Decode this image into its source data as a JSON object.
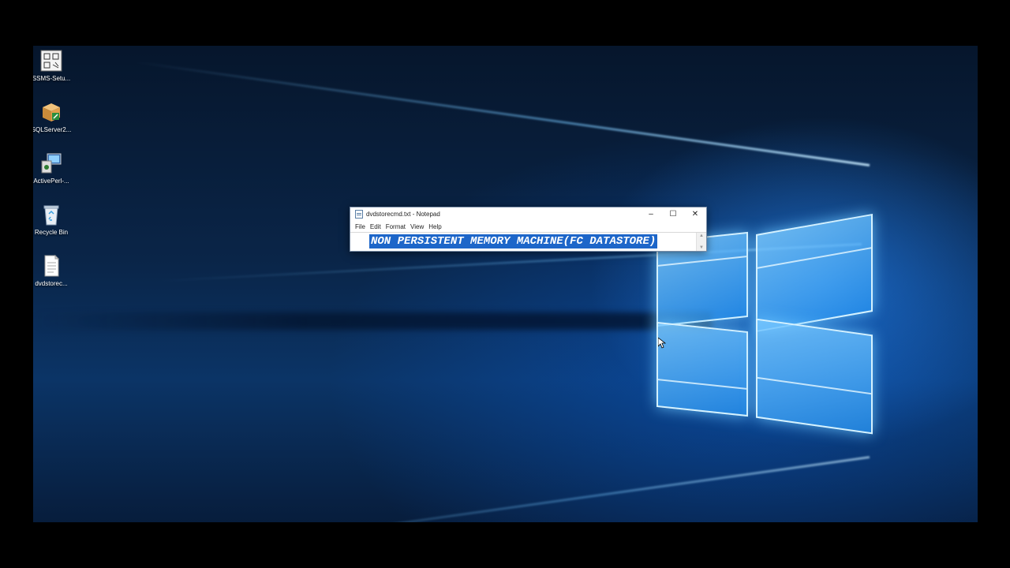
{
  "desktop": {
    "icons": [
      {
        "label": "SSMS-Setu...",
        "icon": "installer-icon"
      },
      {
        "label": "SQLServer2...",
        "icon": "package-icon"
      },
      {
        "label": "ActivePerl-...",
        "icon": "setup-computer-icon"
      },
      {
        "label": "Recycle Bin",
        "icon": "recycle-bin-icon"
      },
      {
        "label": "dvdstorec...",
        "icon": "text-file-icon"
      }
    ]
  },
  "notepad": {
    "title": "dvdstorecmd.txt - Notepad",
    "menu": [
      "File",
      "Edit",
      "Format",
      "View",
      "Help"
    ],
    "content": "NON PERSISTENT MEMORY MACHINE(FC DATASTORE)",
    "selection_color": "#1d66c9",
    "controls": {
      "minimize": "–",
      "maximize": "☐",
      "close": "✕"
    }
  },
  "colors": {
    "wallpaper_dark": "#06162c",
    "wallpaper_glow": "#2d8cff"
  }
}
